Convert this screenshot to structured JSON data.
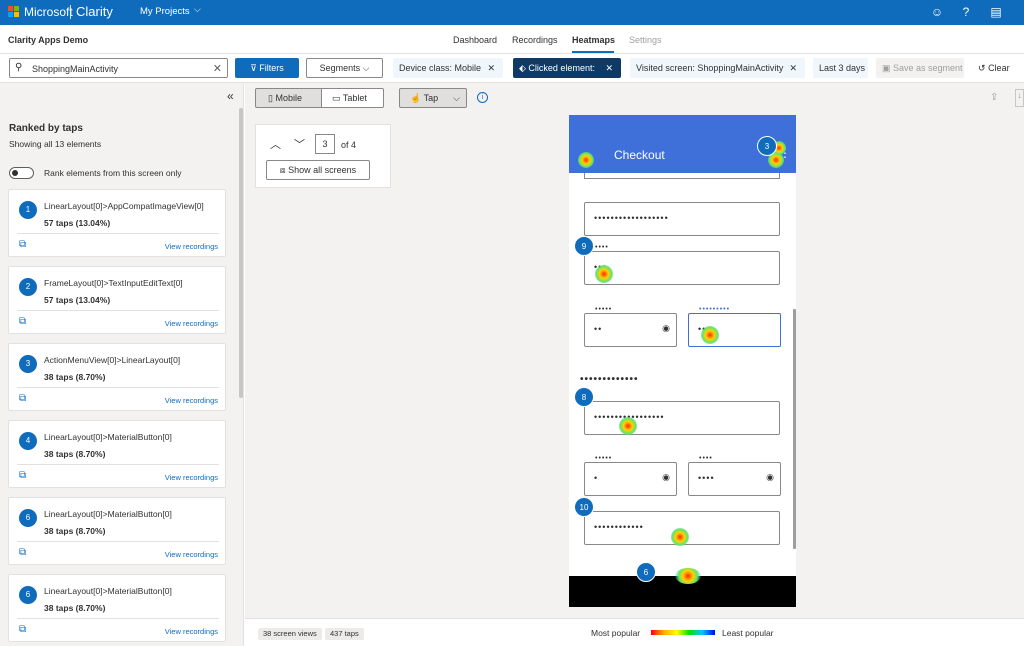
{
  "topbar": {
    "brand": "Microsoft",
    "product": "Clarity",
    "projects": "My Projects"
  },
  "subnav": {
    "app_name": "Clarity Apps Demo",
    "tabs": [
      {
        "label": "Dashboard"
      },
      {
        "label": "Recordings"
      },
      {
        "label": "Heatmaps"
      },
      {
        "label": "Settings"
      }
    ]
  },
  "filters": {
    "search_value": "ShoppingMainActivity",
    "filters_label": "Filters",
    "segments_label": "Segments",
    "chips": [
      {
        "label": "Device class: Mobile"
      },
      {
        "label": "Clicked element:"
      },
      {
        "label": "Visited screen: ShoppingMainActivity"
      }
    ],
    "date_range": "Last 3 days",
    "save_segment": "Save as segment",
    "clear": "Clear"
  },
  "sidebar": {
    "title": "Ranked by taps",
    "subtitle": "Showing all 13 elements",
    "toggle_label": "Rank elements from this screen only",
    "view_recordings": "View recordings",
    "items": [
      {
        "rank": "1",
        "name": "LinearLayout[0]>AppCompatImageView[0]",
        "taps": "57 taps (13.04%)"
      },
      {
        "rank": "2",
        "name": "FrameLayout[0]>TextInputEditText[0]",
        "taps": "57 taps (13.04%)"
      },
      {
        "rank": "3",
        "name": "ActionMenuView[0]>LinearLayout[0]",
        "taps": "38 taps (8.70%)"
      },
      {
        "rank": "4",
        "name": "LinearLayout[0]>MaterialButton[0]",
        "taps": "38 taps (8.70%)"
      },
      {
        "rank": "6",
        "name": "LinearLayout[0]>MaterialButton[0]",
        "taps": "38 taps (8.70%)"
      },
      {
        "rank": "6",
        "name": "LinearLayout[0]>MaterialButton[0]",
        "taps": "38 taps (8.70%)"
      }
    ]
  },
  "toolbar": {
    "mobile": "Mobile",
    "tablet": "Tablet",
    "interaction": "Tap"
  },
  "pager": {
    "current": "3",
    "of": "of 4",
    "show_all": "Show all screens"
  },
  "phone": {
    "title": "Checkout",
    "fields": {
      "f1": "••••••••••••••••••",
      "f2_label": "••••",
      "f2": "•••",
      "f3_label": "•••••",
      "f3": "••",
      "f4_label": "•••••••••",
      "f4": "••••",
      "section": "•••••••••••••",
      "f5": "•••••••••••••••••",
      "f6_label": "•••••",
      "f6": "•",
      "f7_label": "••••",
      "f7": "••••",
      "f8": "••••••••••••"
    },
    "markers": [
      "3",
      "9",
      "8",
      "10",
      "6"
    ]
  },
  "footer": {
    "views": "38 screen views",
    "taps": "437 taps",
    "most": "Most popular",
    "least": "Least popular"
  },
  "colors": {
    "accent": "#0f6cbd",
    "phone_header": "#3f6fd8"
  }
}
